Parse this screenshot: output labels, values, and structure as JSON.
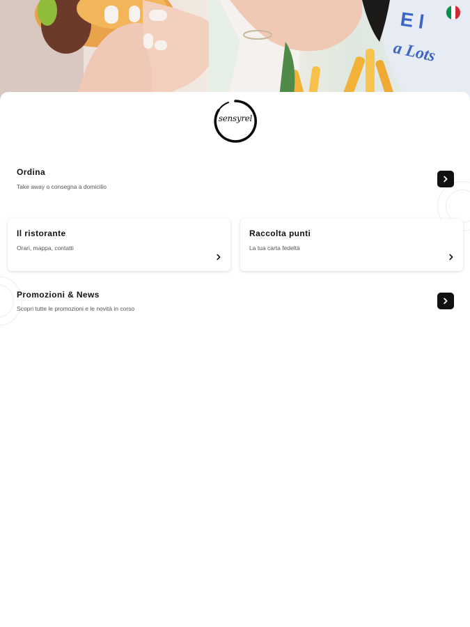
{
  "hero": {
    "flag_icon": "italy-flag-icon",
    "flag_colors": [
      "#009246",
      "#ffffff",
      "#ce2b37"
    ]
  },
  "brand": {
    "logo_text": "sensyrel"
  },
  "menu": {
    "order": {
      "title": "Ordina",
      "subtitle": "Take away o consegna a domicilio",
      "icon": "chevron-right-icon"
    },
    "restaurant": {
      "title": "Il ristorante",
      "subtitle": "Orari, mappa, contatti",
      "icon": "chevron-right-icon"
    },
    "points": {
      "title": "Raccolta punti",
      "subtitle": "La tua carta fedeltà",
      "icon": "chevron-right-icon"
    },
    "news": {
      "title": "Promozioni & News",
      "subtitle": "Scopri tutte le promozioni e le novità in corso",
      "icon": "chevron-right-icon"
    }
  },
  "colors": {
    "accent": "#111111",
    "background": "#ffffff"
  }
}
